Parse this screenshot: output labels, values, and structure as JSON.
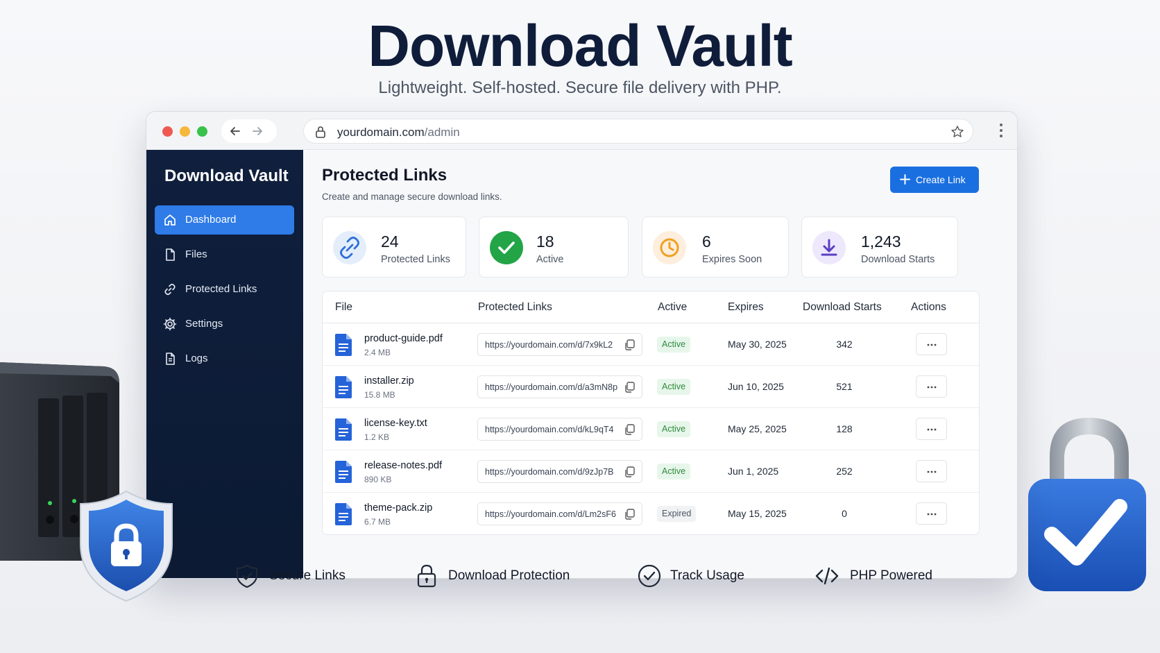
{
  "hero": {
    "title": "Download Vault",
    "subtitle": "Lightweight. Self-hosted. Secure file delivery with PHP."
  },
  "browser": {
    "url_host": "yourdomain.com",
    "url_path": "/admin"
  },
  "sidebar": {
    "brand": "Download Vault",
    "items": [
      {
        "label": "Dashboard",
        "icon": "home-icon",
        "active": true
      },
      {
        "label": "Files",
        "icon": "file-icon",
        "active": false
      },
      {
        "label": "Protected Links",
        "icon": "link-icon",
        "active": false
      },
      {
        "label": "Settings",
        "icon": "gear-icon",
        "active": false
      },
      {
        "label": "Logs",
        "icon": "document-icon",
        "active": false
      }
    ]
  },
  "main": {
    "title": "Protected Links",
    "subtitle": "Create and manage secure download links.",
    "create_label": "Create Link"
  },
  "stats": [
    {
      "value": "24",
      "label": "Protected Links",
      "icon": "link-icon",
      "color": "#2f6fd6"
    },
    {
      "value": "18",
      "label": "Active",
      "icon": "check-circle-icon",
      "color": "#22a447"
    },
    {
      "value": "6",
      "label": "Expires Soon",
      "icon": "clock-icon",
      "color": "#f0a020"
    },
    {
      "value": "1,243",
      "label": "Download Starts",
      "icon": "download-icon",
      "color": "#5a3fc4"
    }
  ],
  "table": {
    "columns": [
      "File",
      "Protected Links",
      "Active",
      "Expires",
      "Download Starts",
      "Actions"
    ],
    "rows": [
      {
        "name": "product-guide.pdf",
        "size": "2.4 MB",
        "link": "https://yourdomain.com/d/7x9kL2",
        "status": "Active",
        "expires": "May 30, 2025",
        "downloads": "342"
      },
      {
        "name": "installer.zip",
        "size": "15.8 MB",
        "link": "https://yourdomain.com/d/a3mN8p",
        "status": "Active",
        "expires": "Jun 10, 2025",
        "downloads": "521"
      },
      {
        "name": "license-key.txt",
        "size": "1.2 KB",
        "link": "https://yourdomain.com/d/kL9qT4",
        "status": "Active",
        "expires": "May 25, 2025",
        "downloads": "128"
      },
      {
        "name": "release-notes.pdf",
        "size": "890 KB",
        "link": "https://yourdomain.com/d/9zJp7B",
        "status": "Active",
        "expires": "Jun 1, 2025",
        "downloads": "252"
      },
      {
        "name": "theme-pack.zip",
        "size": "6.7 MB",
        "link": "https://yourdomain.com/d/Lm2sF6",
        "status": "Expired",
        "expires": "May 15, 2025",
        "downloads": "0"
      }
    ]
  },
  "features": [
    {
      "label": "Secure Links",
      "icon": "shield-check-icon"
    },
    {
      "label": "Download Protection",
      "icon": "lock-icon"
    },
    {
      "label": "Track Usage",
      "icon": "check-circle-icon"
    },
    {
      "label": "PHP Powered",
      "icon": "code-icon"
    }
  ],
  "colors": {
    "accent": "#1a6fe0",
    "sidebar_bg": "#0f1f3d",
    "active_nav": "#2f7be8",
    "status_active": "#2e8b3d",
    "status_expired": "#4b5563"
  }
}
